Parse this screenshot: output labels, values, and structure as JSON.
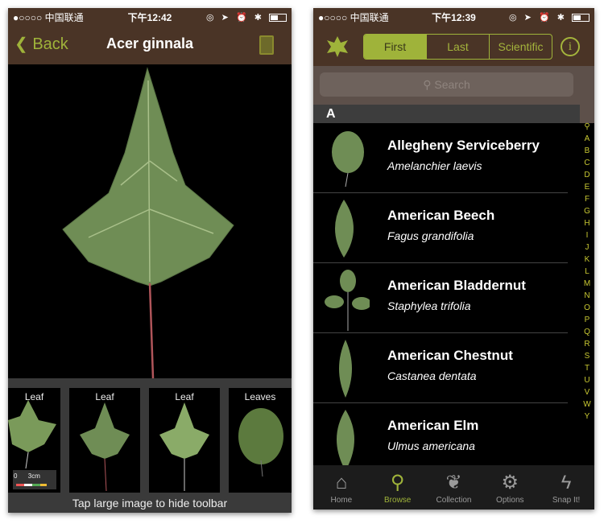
{
  "left": {
    "status": {
      "carrier": "●○○○○ 中国联通",
      "time": "下午12:42"
    },
    "nav": {
      "back": "Back",
      "title": "Acer ginnala"
    },
    "thumbnails": [
      {
        "label": "Leaf"
      },
      {
        "label": "Leaf"
      },
      {
        "label": "Leaf"
      },
      {
        "label": "Leaves"
      }
    ],
    "scale_label": "0      3cm",
    "caption": "Tap large image to hide toolbar"
  },
  "right": {
    "status": {
      "carrier": "●○○○○ 中国联通",
      "time": "下午12:39"
    },
    "segments": [
      "First",
      "Last",
      "Scientific"
    ],
    "selected_segment": "First",
    "info_label": "i",
    "search_placeholder": "Search",
    "section": "A",
    "rows": [
      {
        "name": "Allegheny Serviceberry",
        "sci": "Amelanchier laevis"
      },
      {
        "name": "American Beech",
        "sci": "Fagus grandifolia"
      },
      {
        "name": "American Bladdernut",
        "sci": "Staphylea trifolia"
      },
      {
        "name": "American Chestnut",
        "sci": "Castanea dentata"
      },
      {
        "name": "American Elm",
        "sci": "Ulmus americana"
      }
    ],
    "index": [
      "A",
      "B",
      "C",
      "D",
      "E",
      "F",
      "G",
      "H",
      "I",
      "J",
      "K",
      "L",
      "M",
      "N",
      "O",
      "P",
      "Q",
      "R",
      "S",
      "T",
      "U",
      "V",
      "W",
      "Y"
    ],
    "tabs": [
      {
        "label": "Home",
        "icon": "home-icon"
      },
      {
        "label": "Browse",
        "icon": "browse-icon"
      },
      {
        "label": "Collection",
        "icon": "collection-icon"
      },
      {
        "label": "Options",
        "icon": "gear-icon"
      },
      {
        "label": "Snap It!",
        "icon": "lightning-icon"
      }
    ],
    "active_tab": "Browse"
  },
  "colors": {
    "brown": "#4a3426",
    "accent": "#9fb33a",
    "leaf": "#6e8f4e"
  }
}
